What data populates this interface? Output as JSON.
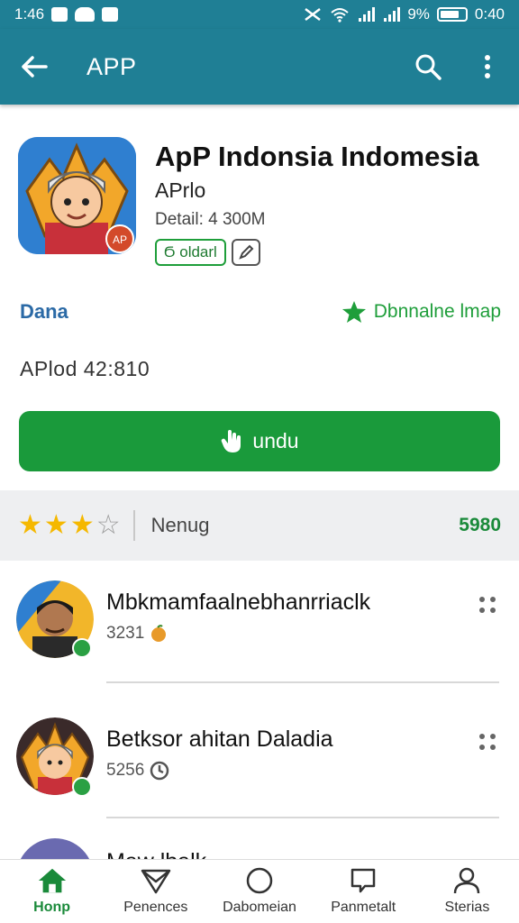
{
  "status_bar": {
    "time": "1:46",
    "battery_text": "9%",
    "right_time": "0:40"
  },
  "app_bar": {
    "title": "APP"
  },
  "app": {
    "name": "ApP Indonsia Indomesia",
    "developer": "APrlo",
    "detail": "Detail: 4 300M",
    "tag": "Ϭ oldarl",
    "meta_left": "Dana",
    "meta_right": "Dbnnalne lmap",
    "version": "APlod 42:810",
    "install_label": "undu"
  },
  "rating": {
    "stars": 3,
    "max": 5,
    "label": "Nenug",
    "count": "5980"
  },
  "reviews": [
    {
      "name": "Mbkmamfaalnebhanrriaclk",
      "count": "3231"
    },
    {
      "name": "Betksor ahitan Daladia",
      "count": "5256"
    },
    {
      "name": "Maw lbalk"
    }
  ],
  "bottom_nav": [
    {
      "label": "Honp",
      "icon": "home-icon",
      "active": true
    },
    {
      "label": "Penences",
      "icon": "send-icon"
    },
    {
      "label": "Dabomeian",
      "icon": "circle-icon"
    },
    {
      "label": "Panmetalt",
      "icon": "chat-icon"
    },
    {
      "label": "Sterias",
      "icon": "person-icon"
    }
  ],
  "colors": {
    "primary": "#1f7f95",
    "install": "#1a9a3b",
    "star": "#f5b800"
  }
}
